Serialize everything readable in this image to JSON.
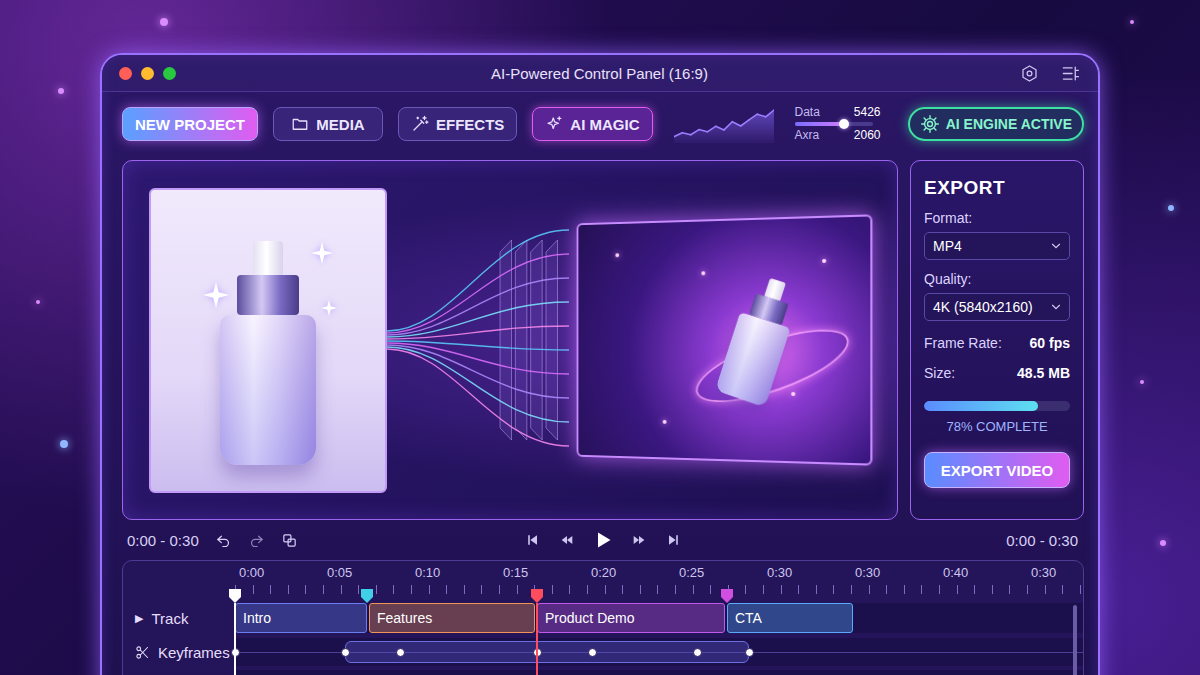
{
  "window": {
    "title": "AI-Powered Control Panel (16:9)"
  },
  "toolbar": {
    "buttons": [
      {
        "label": "NEW PROJECT",
        "kind": "primary"
      },
      {
        "label": "MEDIA",
        "kind": "plain"
      },
      {
        "label": "EFFECTS",
        "kind": "plain"
      },
      {
        "label": "AI MAGIC",
        "kind": "accent"
      }
    ],
    "chart": {
      "values": [
        1,
        2.2,
        1.6,
        3.2,
        2.5,
        4.2,
        3.1,
        5.6,
        4.3,
        6.2,
        7.9,
        7.1,
        9.2
      ]
    },
    "stats": [
      {
        "label": "Data",
        "value": "5426",
        "kind": "slider",
        "level": 0.64
      },
      {
        "label": "Axra",
        "value": "2060",
        "kind": "plain"
      }
    ],
    "engine": {
      "label": "AI ENGINE ACTIVE",
      "active": true
    }
  },
  "export": {
    "title": "EXPORT",
    "fields": [
      {
        "label": "Format:",
        "kind": "select",
        "value": "MP4"
      },
      {
        "label": "Quality:",
        "kind": "select",
        "value": "4K (5840x2160)"
      },
      {
        "label": "Frame Rate:",
        "kind": "pair",
        "value": "60 fps"
      },
      {
        "label": "Size:",
        "kind": "pair",
        "value": "48.5 MB"
      }
    ],
    "progress": {
      "level": 0.78,
      "label": "78% COMPLETE"
    },
    "button": "EXPORT VIDEO"
  },
  "transport": {
    "range_left": "0:00 - 0:30",
    "range_right": "0:00 - 0:30"
  },
  "timeline": {
    "ruler": [
      "0:00",
      "0:05",
      "0:10",
      "0:15",
      "0:20",
      "0:25",
      "0:30",
      "0:30",
      "0:40",
      "0:30"
    ],
    "markers": [
      {
        "color": "#ffffff",
        "line": true
      },
      {
        "color": "#3fd0e8",
        "line": false
      },
      {
        "color": "#ff4d5e",
        "line": true
      },
      {
        "color": "#d14fe0",
        "line": false
      }
    ],
    "track": {
      "toggle": "▶",
      "label": "Track",
      "clips": [
        {
          "label": "Intro",
          "color": "#6a7df0"
        },
        {
          "label": "Features",
          "color": "#f0945a"
        },
        {
          "label": "Product Demo",
          "color": "#c25ae8"
        },
        {
          "label": "CTA",
          "color": "#5aa8ff"
        }
      ]
    },
    "keyframes": {
      "label": "Keyframes"
    }
  }
}
